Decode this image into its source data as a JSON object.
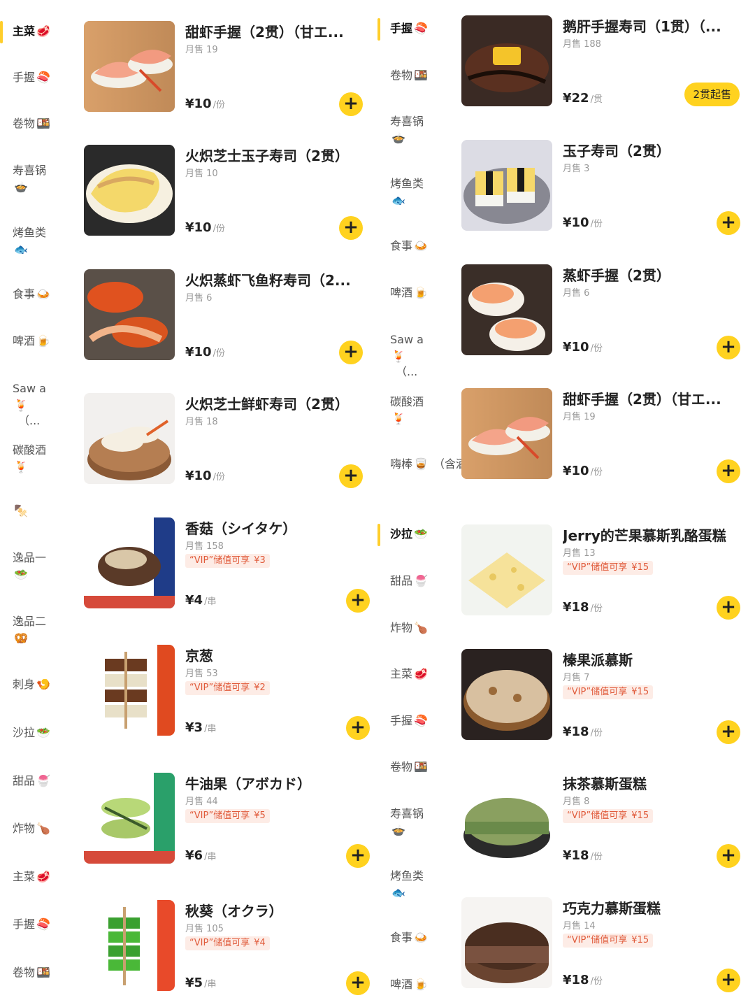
{
  "sidebar_left": {
    "items": [
      {
        "label": "主菜",
        "emoji": "🥩",
        "active": true
      },
      {
        "label": "手握",
        "emoji": "🍣"
      },
      {
        "label": "卷物",
        "emoji": "🍱"
      },
      {
        "label": "寿喜锅",
        "emoji": "🍲"
      },
      {
        "label": "烤鱼类",
        "emoji": "🐟"
      },
      {
        "label": "食事",
        "emoji": "🍛"
      },
      {
        "label": "啤酒",
        "emoji": "🍺"
      },
      {
        "label": "Saw a",
        "emoji": "🍹",
        "extra": "（..."
      },
      {
        "label": "碳酸酒",
        "emoji": "🍹"
      },
      {
        "label": "",
        "emoji": "🍢"
      },
      {
        "label": "逸品一",
        "emoji": "🥗"
      },
      {
        "label": "逸品二",
        "emoji": "🥨"
      },
      {
        "label": "刺身",
        "emoji": "🍤"
      },
      {
        "label": "沙拉",
        "emoji": "🥗"
      },
      {
        "label": "甜品",
        "emoji": "🍧"
      },
      {
        "label": "炸物",
        "emoji": "🍗"
      },
      {
        "label": "主菜",
        "emoji": "🥩"
      },
      {
        "label": "手握",
        "emoji": "🍣"
      },
      {
        "label": "卷物",
        "emoji": "🍱"
      }
    ]
  },
  "sidebar_right": {
    "items": [
      {
        "label": "手握",
        "emoji": "🍣",
        "active": true
      },
      {
        "label": "卷物",
        "emoji": "🍱"
      },
      {
        "label": "寿喜锅",
        "emoji": "🍲"
      },
      {
        "label": "烤鱼类",
        "emoji": "🐟"
      },
      {
        "label": "食事",
        "emoji": "🍛"
      },
      {
        "label": "啤酒",
        "emoji": "🍺"
      },
      {
        "label": "Saw a",
        "emoji": "🍹",
        "extra": "（..."
      },
      {
        "label": "碳酸酒",
        "emoji": "🍹"
      },
      {
        "label": "嗨棒",
        "emoji": "🥃",
        "extra": "（含酒..."
      },
      {
        "label": "沙拉",
        "emoji": "🥗",
        "active": true
      },
      {
        "label": "甜品",
        "emoji": "🍧"
      },
      {
        "label": "炸物",
        "emoji": "🍗"
      },
      {
        "label": "主菜",
        "emoji": "🥩"
      },
      {
        "label": "手握",
        "emoji": "🍣"
      },
      {
        "label": "卷物",
        "emoji": "🍱"
      },
      {
        "label": "寿喜锅",
        "emoji": "🍲"
      },
      {
        "label": "烤鱼类",
        "emoji": "🐟"
      },
      {
        "label": "食事",
        "emoji": "🍛"
      },
      {
        "label": "啤酒",
        "emoji": "🍺"
      }
    ]
  },
  "products_left": [
    {
      "title": "甜虾手握（2贯）（甘エ...",
      "sold": "月售 19",
      "price": "¥10",
      "unit": "/份",
      "img": "sweet-shrimp"
    },
    {
      "title": "火炽芝士玉子寿司（2贯）",
      "sold": "月售 10",
      "price": "¥10",
      "unit": "/份",
      "img": "cheese-egg"
    },
    {
      "title": "火炽蒸虾飞鱼籽寿司（2...",
      "sold": "月售 6",
      "price": "¥10",
      "unit": "/份",
      "img": "shrimp-roe"
    },
    {
      "title": "火炽芝士鲜虾寿司（2贯）",
      "sold": "月售 18",
      "price": "¥10",
      "unit": "/份",
      "img": "cheese-shrimp"
    },
    {
      "title": "香菇（シイタケ）",
      "sold": "月售 158",
      "vip": "“VIP”储值可享",
      "vip_price": "¥3",
      "price": "¥4",
      "unit": "/串",
      "img": "mushroom"
    },
    {
      "title": "京葱",
      "sold": "月售 53",
      "vip": "“VIP”储值可享",
      "vip_price": "¥2",
      "price": "¥3",
      "unit": "/串",
      "img": "negi"
    },
    {
      "title": "牛油果（アボカド）",
      "sold": "月售 44",
      "vip": "“VIP”储值可享",
      "vip_price": "¥5",
      "price": "¥6",
      "unit": "/串",
      "img": "avocado"
    },
    {
      "title": "秋葵（オクラ）",
      "sold": "月售 105",
      "vip": "“VIP”储值可享",
      "vip_price": "¥4",
      "price": "¥5",
      "unit": "/串",
      "img": "okra"
    }
  ],
  "products_right": [
    {
      "title": "鹅肝手握寿司（1贯）（...",
      "sold": "月售 188",
      "price": "¥22",
      "unit": "/贯",
      "badge": "2贯起售",
      "img": "foie-gras"
    },
    {
      "title": "玉子寿司（2贯）",
      "sold": "月售 3",
      "price": "¥10",
      "unit": "/份",
      "img": "tamago"
    },
    {
      "title": "蒸虾手握（2贯）",
      "sold": "月售 6",
      "price": "¥10",
      "unit": "/份",
      "img": "steamed-shrimp"
    },
    {
      "title": "甜虾手握（2贯）（甘エ...",
      "sold": "月售 19",
      "price": "¥10",
      "unit": "/份",
      "img": "sweet-shrimp"
    },
    {
      "title": "Jerry的芒果慕斯乳酪蛋糕",
      "sold": "月售 13",
      "vip": "“VIP”储值可享",
      "vip_price": "¥15",
      "price": "¥18",
      "unit": "/份",
      "img": "mango-cake"
    },
    {
      "title": "榛果派慕斯",
      "sold": "月售 7",
      "vip": "“VIP”储值可享",
      "vip_price": "¥15",
      "price": "¥18",
      "unit": "/份",
      "img": "hazelnut-pie"
    },
    {
      "title": "抹茶慕斯蛋糕",
      "sold": "月售 8",
      "vip": "“VIP”储值可享",
      "vip_price": "¥15",
      "price": "¥18",
      "unit": "/份",
      "img": "matcha-cake"
    },
    {
      "title": "巧克力慕斯蛋糕",
      "sold": "月售 14",
      "vip": "“VIP”储值可享",
      "vip_price": "¥15",
      "price": "¥18",
      "unit": "/份",
      "img": "chocolate-cake"
    }
  ]
}
